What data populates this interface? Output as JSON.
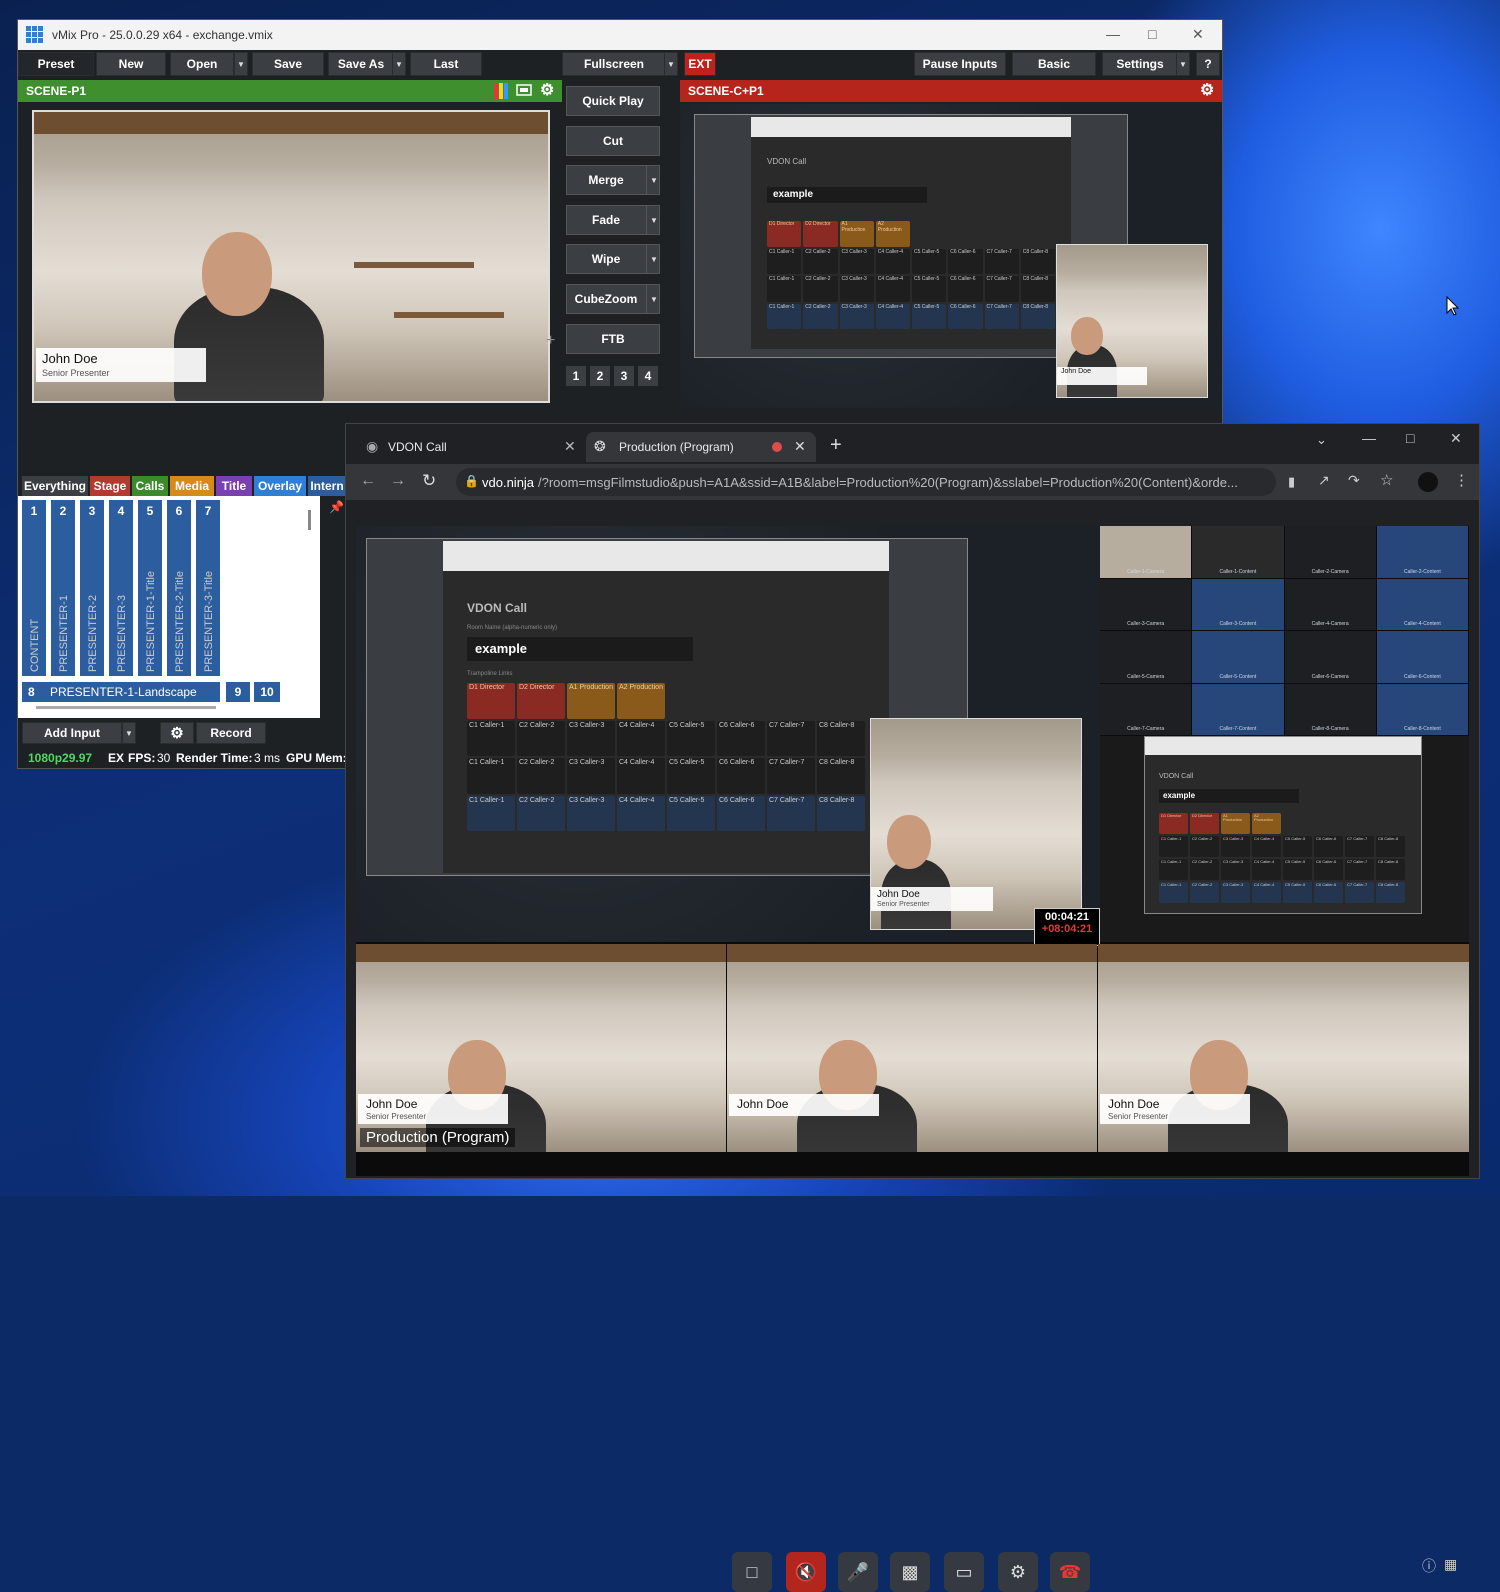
{
  "vmix": {
    "window_title": "vMix Pro - 25.0.0.29 x64 - exchange.vmix",
    "toolbar": {
      "preset": "Preset",
      "new": "New",
      "open": "Open",
      "save": "Save",
      "save_as": "Save As",
      "last": "Last",
      "fullscreen": "Fullscreen",
      "ext": "EXT",
      "pause_inputs": "Pause Inputs",
      "basic": "Basic",
      "settings": "Settings",
      "help": "?"
    },
    "preview_label": "SCENE-P1",
    "program_label": "SCENE-C+P1",
    "transitions": [
      "Quick Play",
      "Cut",
      "Merge",
      "Fade",
      "Wipe",
      "CubeZoom",
      "FTB"
    ],
    "transition_numbers": [
      "1",
      "2",
      "3",
      "4"
    ],
    "lower_third": {
      "name": "John Doe",
      "title": "Senior Presenter"
    },
    "category_tabs": [
      "Everything",
      "Stage",
      "Calls",
      "Media",
      "Title",
      "Overlay",
      "Intern"
    ],
    "inputs": [
      {
        "num": "1",
        "name": "CONTENT"
      },
      {
        "num": "2",
        "name": "PRESENTER-1"
      },
      {
        "num": "3",
        "name": "PRESENTER-2"
      },
      {
        "num": "4",
        "name": "PRESENTER-3"
      },
      {
        "num": "5",
        "name": "PRESENTER-1-Title"
      },
      {
        "num": "6",
        "name": "PRESENTER-2-Title"
      },
      {
        "num": "7",
        "name": "PRESENTER-3-Title"
      }
    ],
    "input_row2": {
      "num": "8",
      "name": "PRESENTER-1-Landscape",
      "num9": "9",
      "num10": "10"
    },
    "bottom": {
      "add_input": "Add Input",
      "record": "Record",
      "resolution": "1080p29.97",
      "ex": "EX",
      "fps_label": "FPS:",
      "fps": "30",
      "render_label": "Render Time:",
      "render": "3 ms",
      "gpu_label": "GPU Mem:"
    }
  },
  "vdo_screen": {
    "title": "VDON Call",
    "room_label": "Room Name (alpha-numeric only)",
    "room": "example",
    "trampoline": "Trampoline Links",
    "top_cells": [
      {
        "code": "D1",
        "sub": "Director"
      },
      {
        "code": "D2",
        "sub": "Director"
      },
      {
        "code": "A1",
        "sub": "Production"
      },
      {
        "code": "A2",
        "sub": "Production"
      }
    ],
    "grid_codes": [
      "C1",
      "C2",
      "C3",
      "C4",
      "C5",
      "C6",
      "C7",
      "C8"
    ],
    "grid_subs": [
      "Caller-1",
      "Caller-2",
      "Caller-3",
      "Caller-4",
      "Caller-5",
      "Caller-6",
      "Caller-7",
      "Caller-8"
    ]
  },
  "browser": {
    "tab1": "VDON Call",
    "tab2": "Production (Program)",
    "url_host": "vdo.ninja",
    "url_path": "/?room=msgFilmstudio&push=A1A&ssid=A1B&label=Production%20(Program)&sslabel=Production%20(Content)&orde...",
    "timer": "00:04:21",
    "timer_delta": "+08:04:21",
    "stream_label": "Production (Program)",
    "overview_labels": [
      "Caller-1-Camera",
      "Caller-1-Content",
      "Caller-2-Camera",
      "Caller-2-Content",
      "Caller-3-Camera",
      "Caller-3-Content",
      "Caller-4-Camera",
      "Caller-4-Content",
      "Caller-5-Camera",
      "Caller-5-Content",
      "Caller-6-Camera",
      "Caller-6-Content",
      "Caller-7-Camera",
      "Caller-7-Content",
      "Caller-8-Camera",
      "Caller-8-Content"
    ]
  },
  "colors": {
    "preview_green": "#3f8f2f",
    "program_red": "#b5251c",
    "ext_red": "#c0221b",
    "tab_stage": "#b33a2e",
    "tab_calls": "#3b8a2c",
    "tab_media": "#d58a1a",
    "tab_title": "#7a3fb0",
    "tab_overlay": "#2f7fd6",
    "input_blue": "#2c5d9e"
  }
}
